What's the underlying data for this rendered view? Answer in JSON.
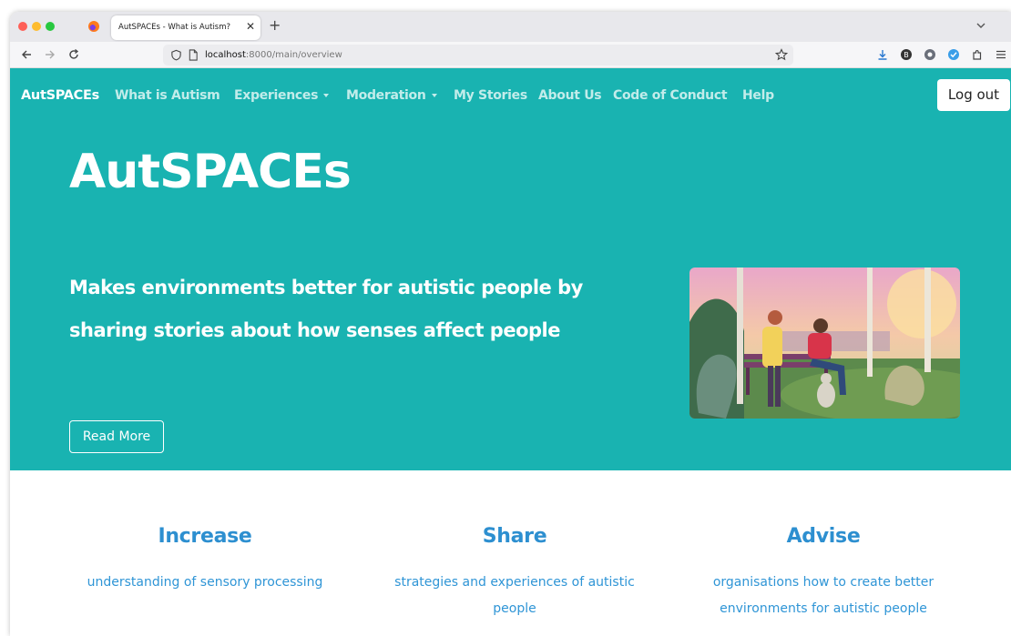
{
  "browser": {
    "tab_title": "AutSPACEs - What is Autism?",
    "tab_close": "✕",
    "new_tab": "+",
    "url_host": "localhost",
    "url_path": ":8000/main/overview"
  },
  "site": {
    "brand": "AutSPACEs",
    "nav": [
      {
        "label": "What is Autism"
      },
      {
        "label": "Experiences"
      },
      {
        "label": "Moderation"
      },
      {
        "label": "My Stories"
      },
      {
        "label": "About Us"
      },
      {
        "label": "Code of Conduct"
      },
      {
        "label": "Help"
      }
    ],
    "logout_label": "Log out"
  },
  "hero": {
    "title": "AutSPACEs",
    "subtitle": "Makes environments better for autistic people by sharing stories about how senses affect people",
    "read_more": "Read More"
  },
  "features": [
    {
      "title": "Increase",
      "text": "understanding of sensory processing"
    },
    {
      "title": "Share",
      "text": "strategies and experiences of autistic people"
    },
    {
      "title": "Advise",
      "text": "organisations how to create better environments for autistic people"
    }
  ],
  "colors": {
    "accent": "#19b3b1",
    "feature_blue": "#2d8fd0"
  }
}
